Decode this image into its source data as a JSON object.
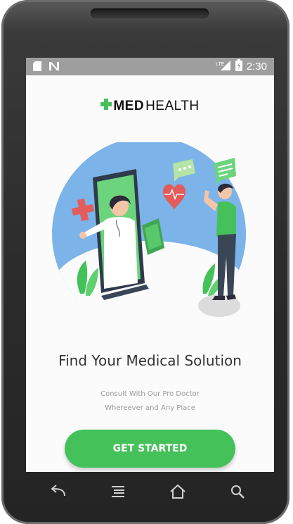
{
  "status_bar": {
    "time": "2:30",
    "lte": "LTE"
  },
  "logo": {
    "bold": "MED",
    "light": "HEALTH"
  },
  "hero": {
    "title": "Find Your Medical Solution",
    "subtitle_line1": "Consult With Our Pro Doctor",
    "subtitle_line2": "Whereever and Any Place"
  },
  "cta": {
    "label": "GET STARTED"
  },
  "colors": {
    "brand_green": "#45c15a",
    "illustration_blue": "#7cb3e8",
    "status_bar": "#9e9e9e"
  },
  "nav_icons": [
    "back-icon",
    "menu-icon",
    "home-icon",
    "search-icon"
  ]
}
